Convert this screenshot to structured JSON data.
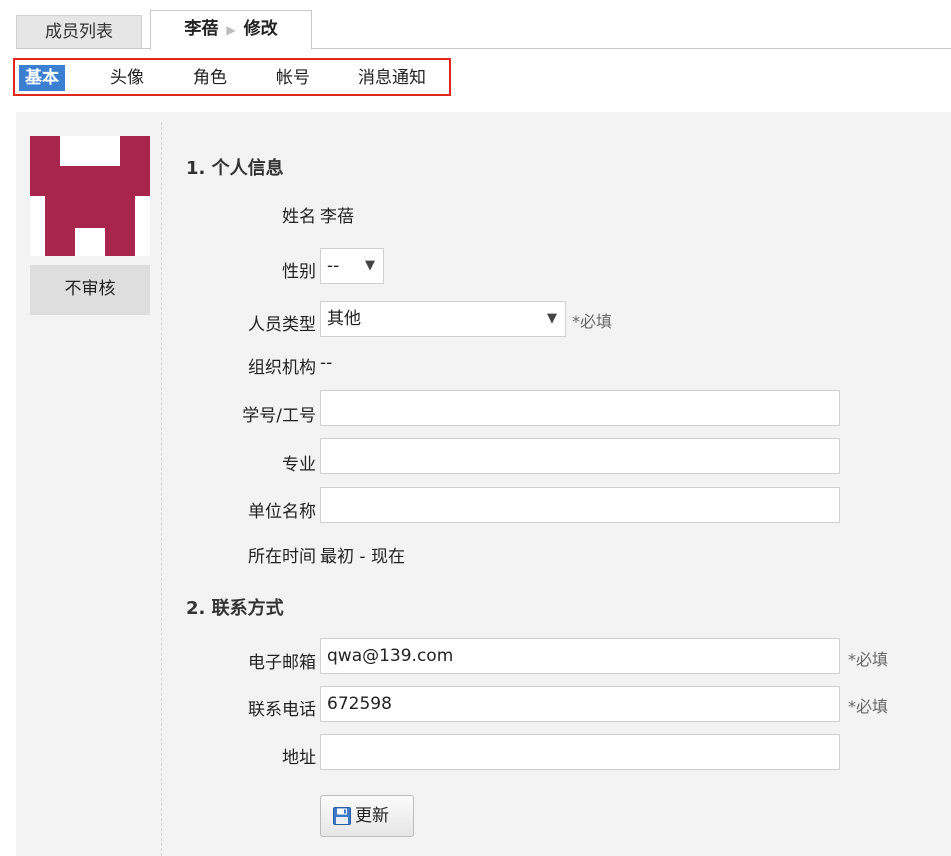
{
  "top_tabs": {
    "list_label": "成员列表",
    "edit_name": "李蓓",
    "edit_arrow": "▶",
    "edit_action": "修改"
  },
  "sub_tabs": [
    "基本",
    "头像",
    "角色",
    "帐号",
    "消息通知"
  ],
  "sidebar": {
    "review_label": "不审核",
    "avatar_color": "#a8254d"
  },
  "section1": {
    "title": "1. 个人信息",
    "name_label": "姓名",
    "name_value": "李蓓",
    "gender_label": "性别",
    "gender_value": "--",
    "type_label": "人员类型",
    "type_value": "其他",
    "required": "*必填",
    "org_label": "组织机构",
    "org_value": "--",
    "id_label": "学号/工号",
    "id_value": "",
    "major_label": "专业",
    "major_value": "",
    "unit_label": "单位名称",
    "unit_value": "",
    "time_label": "所在时间",
    "time_value": "最初 - 现在"
  },
  "section2": {
    "title": "2. 联系方式",
    "email_label": "电子邮箱",
    "email_value": "qwa@139.com",
    "phone_label": "联系电话",
    "phone_value": "672598",
    "address_label": "地址",
    "address_value": "",
    "required": "*必填"
  },
  "actions": {
    "update_label": "更新"
  },
  "colors": {
    "active_tab": "#3a7fd1",
    "highlight_border": "#e0251b"
  }
}
